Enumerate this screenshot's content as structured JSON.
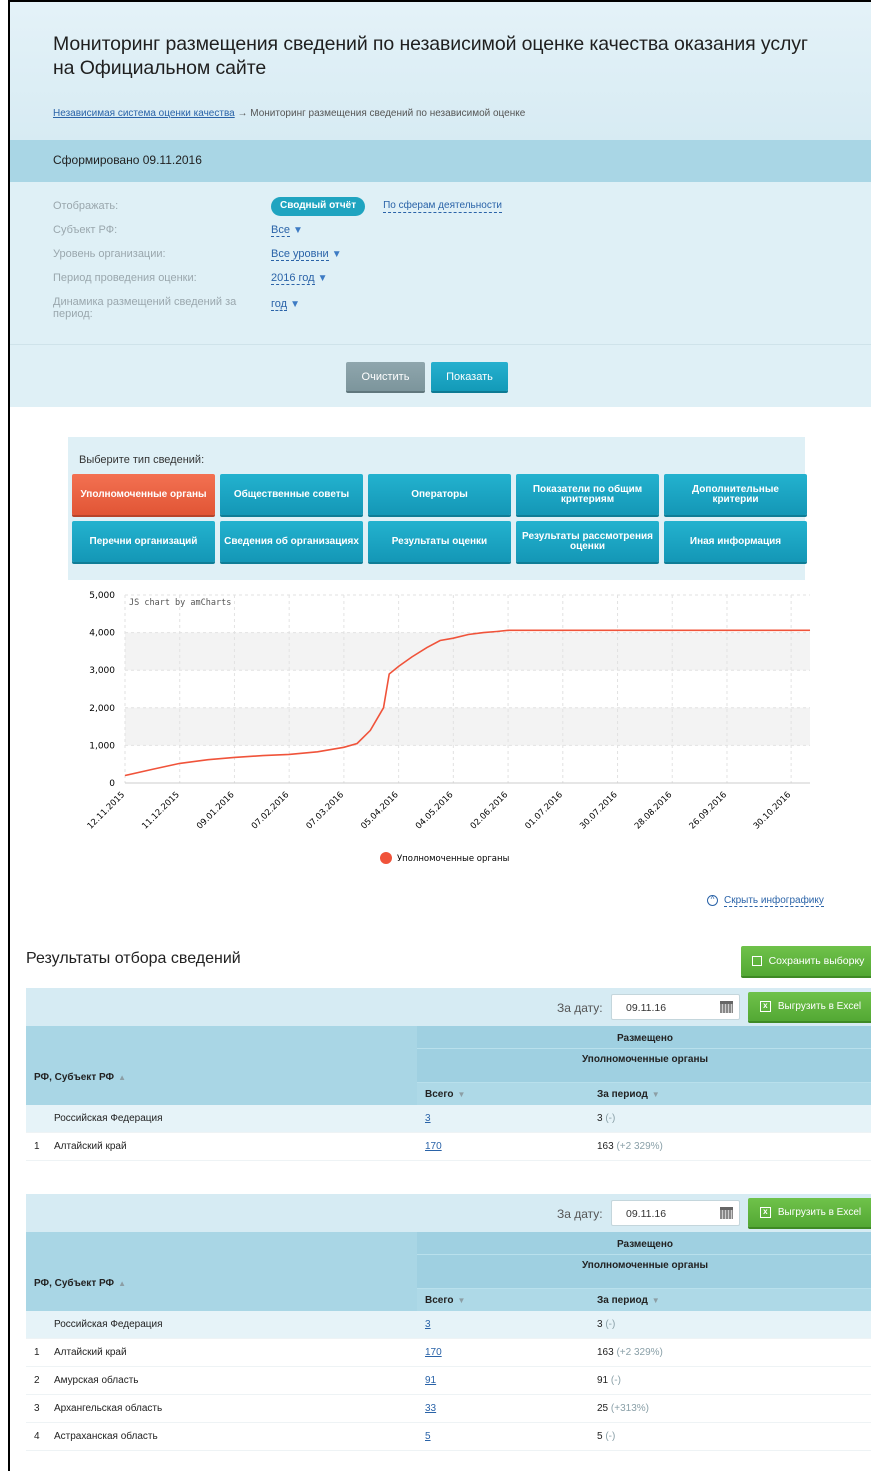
{
  "header": {
    "title": "Мониторинг размещения сведений по независимой оценке качества оказания услуг на Официальном сайте",
    "breadcrumb_link": "Независимая система оценки качества",
    "breadcrumb_sep": "→",
    "breadcrumb_current": "Мониторинг размещения сведений по независимой оценке"
  },
  "formed": "Сформировано 09.11.2016",
  "filters": {
    "display_label": "Отображать:",
    "display_active": "Сводный отчёт",
    "display_other": "По сферам деятельности",
    "subject_label": "Субъект РФ:",
    "subject_value": "Все",
    "level_label": "Уровень организации:",
    "level_value": "Все уровни",
    "period_label": "Период проведения оценки:",
    "period_value": "2016 год",
    "dynamics_label": "Динамика размещений сведений за период:",
    "dynamics_value": "год",
    "clear": "Очистить",
    "show": "Показать"
  },
  "types": {
    "title": "Выберите тип сведений:",
    "buttons": [
      "Уполномоченные органы",
      "Общественные советы",
      "Операторы",
      "Показатели по общим критериям",
      "Дополнительные критерии",
      "Перечни организаций",
      "Сведения об организациях",
      "Результаты оценки",
      "Результаты рассмотрения оценки",
      "Иная информация"
    ],
    "active_index": 0
  },
  "chart_data": {
    "type": "line",
    "watermark": "JS chart by amCharts",
    "yticks": [
      "5,000",
      "4,000",
      "3,000",
      "2,000",
      "1,000",
      "0"
    ],
    "ylim": [
      0,
      5000
    ],
    "xticks": [
      "12.11.2015",
      "11.12.2015",
      "09.01.2016",
      "07.02.2016",
      "07.03.2016",
      "05.04.2016",
      "04.05.2016",
      "02.06.2016",
      "01.07.2016",
      "30.07.2016",
      "28.08.2016",
      "26.09.2016",
      "30.10.2016"
    ],
    "series": [
      {
        "name": "Уполномоченные органы",
        "color": "#f0533a",
        "x": [
          "12.11.2015",
          "27.11.2015",
          "11.12.2015",
          "26.12.2015",
          "09.01.2016",
          "24.01.2016",
          "07.02.2016",
          "22.02.2016",
          "07.03.2016",
          "14.03.2016",
          "21.03.2016",
          "28.03.2016",
          "31.03.2016",
          "05.04.2016",
          "12.04.2016",
          "20.04.2016",
          "27.04.2016",
          "04.05.2016",
          "12.05.2016",
          "20.05.2016",
          "27.05.2016",
          "02.06.2016",
          "01.07.2016",
          "30.07.2016",
          "28.08.2016",
          "26.09.2016",
          "30.10.2016",
          "09.11.2016"
        ],
        "values": [
          200,
          370,
          520,
          620,
          680,
          730,
          760,
          830,
          950,
          1050,
          1400,
          2000,
          2900,
          3100,
          3350,
          3600,
          3790,
          3850,
          3950,
          4000,
          4030,
          4060,
          4060,
          4060,
          4060,
          4060,
          4060,
          4060
        ]
      }
    ],
    "legend_position": "bottom"
  },
  "hide_infographic": "Скрыть инфографику",
  "results_title": "Результаты отбора сведений",
  "save_selection": "Сохранить выборку",
  "table": {
    "date_label": "За дату:",
    "date_value": "09.11.16",
    "excel": "Выгрузить в Excel",
    "col_subject": "РФ, Субъект РФ",
    "col_placed": "Размещено",
    "col_group": "Уполномоченные органы",
    "col_total": "Всего",
    "col_period": "За период",
    "rows_a": [
      {
        "num": "",
        "name": "Российская Федерация",
        "total": "3",
        "period": "3",
        "delta": "(-)"
      },
      {
        "num": "1",
        "name": "Алтайский край",
        "total": "170",
        "period": "163",
        "delta": "(+2 329%)"
      }
    ],
    "rows_b": [
      {
        "num": "",
        "name": "Российская Федерация",
        "total": "3",
        "period": "3",
        "delta": "(-)"
      },
      {
        "num": "1",
        "name": "Алтайский край",
        "total": "170",
        "period": "163",
        "delta": "(+2 329%)"
      },
      {
        "num": "2",
        "name": "Амурская область",
        "total": "91",
        "period": "91",
        "delta": "(-)"
      },
      {
        "num": "3",
        "name": "Архангельская область",
        "total": "33",
        "period": "25",
        "delta": "(+313%)"
      },
      {
        "num": "4",
        "name": "Астраханская область",
        "total": "5",
        "period": "5",
        "delta": "(-)"
      }
    ]
  }
}
